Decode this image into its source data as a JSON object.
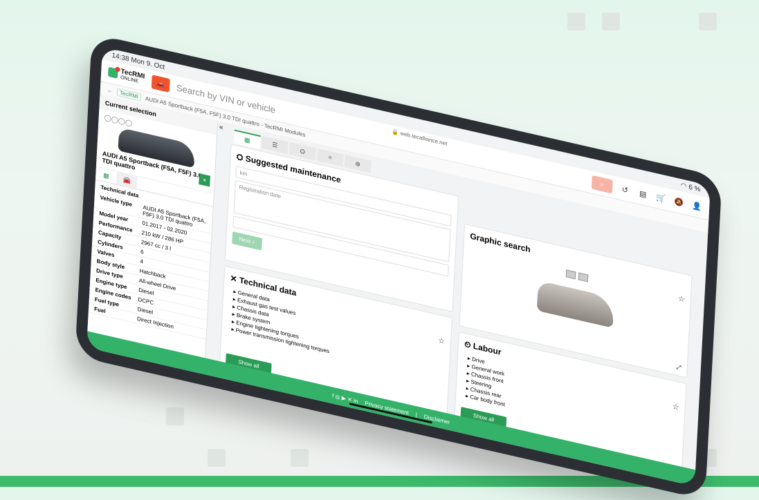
{
  "status": {
    "time": "14:38",
    "date": "Mon 9. Oct",
    "battery": "6 %"
  },
  "app": {
    "logo_line1": "TecRMI",
    "logo_line2": "ONLINE",
    "url": "web.tecalliance.net"
  },
  "search": {
    "placeholder": "Search by VIN or vehicle"
  },
  "breadcrumb": {
    "tag": "TecRMI",
    "path": "AUDI A5 Sportback (F5A, F5F) 3.0 TDI quattro - TecRMI Modules"
  },
  "sidebar": {
    "heading": "Current selection",
    "brand": "AUDI",
    "vehicle_name": "AUDI A5 Sportback (F5A, F5F) 3.0 TDI quattro",
    "close_label": "×",
    "tech_title": "Technical data",
    "specs": [
      {
        "k": "Vehicle type",
        "v": "AUDI A5 Sportback (F5A, F5F) 3.0 TDI quattro"
      },
      {
        "k": "Model year",
        "v": "01.2017 - 02.2020"
      },
      {
        "k": "Performance",
        "v": "210 kW / 286 HP"
      },
      {
        "k": "Capacity",
        "v": "2967 cc / 3 l"
      },
      {
        "k": "Cylinders",
        "v": "6"
      },
      {
        "k": "Valves",
        "v": "4"
      },
      {
        "k": "Body style",
        "v": "Hatchback"
      },
      {
        "k": "Drive type",
        "v": "All-wheel Drive"
      },
      {
        "k": "Engine type",
        "v": "Diesel"
      },
      {
        "k": "Engine codes",
        "v": "DCPC"
      },
      {
        "k": "Fuel type",
        "v": "Diesel"
      },
      {
        "k": "Fuel",
        "v": "Direct Injection"
      }
    ]
  },
  "maintenance": {
    "title": "Suggested maintenance",
    "km_placeholder": "km",
    "reg_placeholder": "Registration date",
    "next_label": "Next"
  },
  "graphic": {
    "title": "Graphic search"
  },
  "technical": {
    "title": "Technical data",
    "items": [
      "General data",
      "Exhaust gas test values",
      "Chassis data",
      "Brake system",
      "Engine tightening torques",
      "Power transmission tightening torques"
    ],
    "show_all": "Show all"
  },
  "labour": {
    "title": "Labour",
    "items": [
      "Drive",
      "General work",
      "Chassis front",
      "Steering",
      "Chassis rear",
      "Car body front"
    ],
    "show_all": "Show all"
  },
  "footer": {
    "privacy": "Privacy statement",
    "separator": "|",
    "disclaimer": "Disclaimer"
  },
  "colors": {
    "brand_green": "#35b26a",
    "vin_orange": "#f0532c"
  }
}
